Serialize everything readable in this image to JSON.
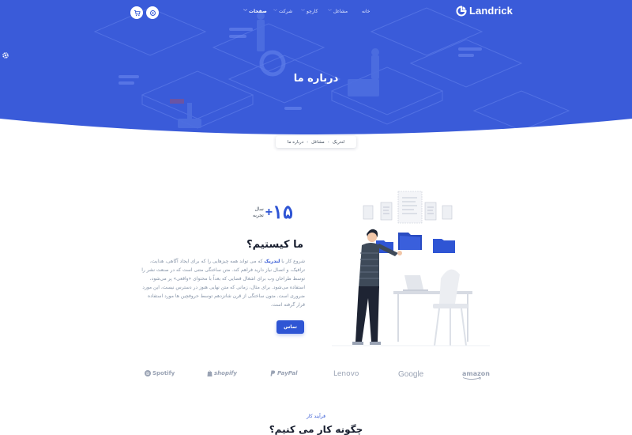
{
  "brand": {
    "name": "Landrick"
  },
  "nav": {
    "items": [
      {
        "label": "خانه",
        "has_dropdown": false,
        "active": false
      },
      {
        "label": "مشاغل",
        "has_dropdown": true,
        "active": false
      },
      {
        "label": "کارچو",
        "has_dropdown": true,
        "active": false
      },
      {
        "label": "شرکت",
        "has_dropdown": true,
        "active": false
      },
      {
        "label": "صفحات",
        "has_dropdown": true,
        "active": true
      }
    ],
    "icons": [
      "settings-icon",
      "cart-icon"
    ]
  },
  "hero": {
    "title": "درباره ما"
  },
  "breadcrumb": {
    "items": [
      "لندریک",
      "مشاغل",
      "درباره ما"
    ]
  },
  "about": {
    "stat_number": "۱۵",
    "stat_plus": "+",
    "stat_label_1": "سال",
    "stat_label_2": "تجربه",
    "title": "ما کیستیم؟",
    "text_pre": "شروع کار با ",
    "text_brand": "لندریک",
    "text_post": " که می تواند همه چیزهایی را که برای ایجاد آگاهی، هدایت، ترافیک، و اتصال نیاز دارید فراهم کند. متن ساختگی متنی است که در صنعت نشر را توسط طراحان وب برای اشغال فضایی که بعداً با محتوای «واقعی» پر می‌شود، استفاده می‌شود. برای مثال، زمانی که متن نهایی هنوز در دسترس نیست، این مورد ضروری است. متون ساختگی از قرن شانزدهم توسط حروفچین ها مورد استفاده قرار گرفته است.",
    "button": "تماس"
  },
  "partners": [
    "Spotify",
    "shopify",
    "PayPal",
    "Lenovo",
    "Google",
    "amazon"
  ],
  "process": {
    "subtitle": "فرآیند کار",
    "title": "چگونه کار می کنیم؟"
  },
  "colors": {
    "primary": "#2f55d4",
    "hero": "#3a5bd9",
    "heading": "#161c2d",
    "muted": "#8492a6"
  }
}
